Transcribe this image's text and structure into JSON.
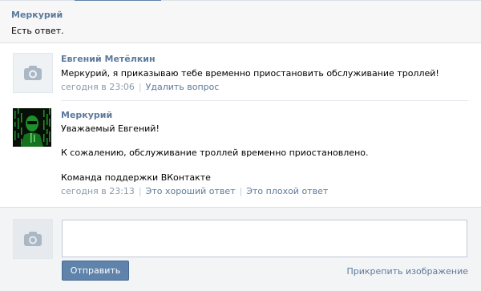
{
  "header": {
    "title": "Меркурий",
    "status": "Есть ответ."
  },
  "comments": [
    {
      "author": "Евгений Метёлкин",
      "text": "Меркурий, я приказываю тебе временно приостановить обслуживание троллей!",
      "time": "сегодня в 23:06",
      "action": "Удалить вопрос"
    },
    {
      "author": "Меркурий",
      "lines": [
        "Уважаемый Евгений!",
        "К сожалению, обслуживание троллей временно приостановлено.",
        "Команда поддержки ВКонтакте"
      ],
      "time": "сегодня в 23:13",
      "actions": [
        "Это хороший ответ",
        "Это плохой ответ"
      ]
    }
  ],
  "reply": {
    "input_value": "",
    "send_label": "Отправить",
    "attach_label": "Прикрепить изображение"
  },
  "icons": {
    "camera": "camera-icon"
  },
  "colors": {
    "link": "#5b7a9c",
    "button": "#5f83aa",
    "meta": "#8a9aab"
  }
}
